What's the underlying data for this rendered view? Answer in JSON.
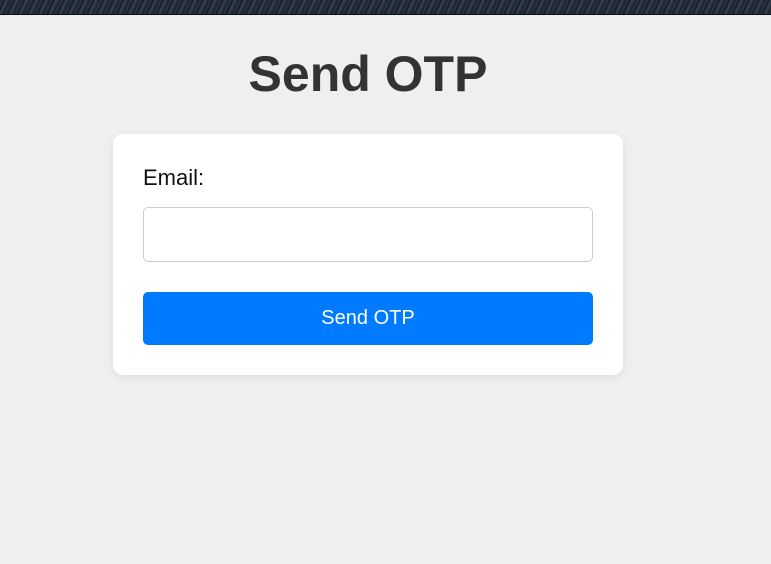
{
  "page": {
    "title": "Send OTP"
  },
  "form": {
    "email_label": "Email:",
    "email_value": "",
    "email_placeholder": "",
    "submit_label": "Send OTP"
  },
  "colors": {
    "background": "#efefef",
    "card": "#ffffff",
    "button": "#007bff",
    "title_text": "#333333"
  }
}
